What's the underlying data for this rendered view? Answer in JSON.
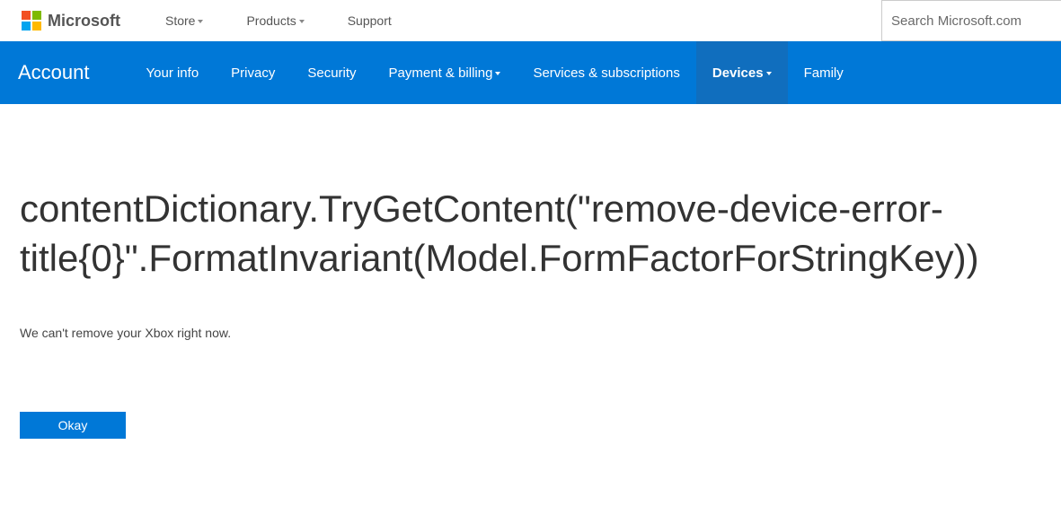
{
  "header": {
    "brand": "Microsoft",
    "nav": [
      {
        "label": "Store",
        "dropdown": true
      },
      {
        "label": "Products",
        "dropdown": true
      },
      {
        "label": "Support",
        "dropdown": false
      }
    ],
    "search_placeholder": "Search Microsoft.com"
  },
  "account_nav": {
    "title": "Account",
    "items": [
      {
        "label": "Your info",
        "dropdown": false,
        "active": false
      },
      {
        "label": "Privacy",
        "dropdown": false,
        "active": false
      },
      {
        "label": "Security",
        "dropdown": false,
        "active": false
      },
      {
        "label": "Payment & billing",
        "dropdown": true,
        "active": false
      },
      {
        "label": "Services & subscriptions",
        "dropdown": false,
        "active": false
      },
      {
        "label": "Devices",
        "dropdown": true,
        "active": true
      },
      {
        "label": "Family",
        "dropdown": false,
        "active": false
      }
    ]
  },
  "main": {
    "error_title": "contentDictionary.TryGetContent(\"remove-device-error-title{0}\".FormatInvariant(Model.FormFactorForStringKey))",
    "error_message": "We can't remove your Xbox right now.",
    "okay_label": "Okay"
  }
}
